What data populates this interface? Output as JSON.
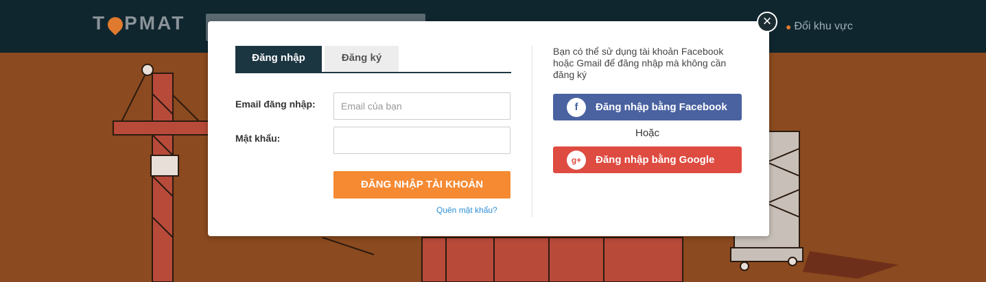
{
  "header": {
    "logo_text_left": "T",
    "logo_text_right": "PMAT",
    "region_label": "Đổi khu vực"
  },
  "modal": {
    "close_symbol": "×",
    "tabs": [
      {
        "label": "Đăng nhập",
        "active": true
      },
      {
        "label": "Đăng ký",
        "active": false
      }
    ],
    "email_label": "Email đăng nhập:",
    "email_placeholder": "Email của bạn",
    "email_value": "",
    "password_label": "Mật khẩu:",
    "password_value": "",
    "login_button": "ĐĂNG NHẬP TÀI KHOẢN",
    "forgot_link": "Quên mật khẩu?",
    "social_info": "Bạn có thể sử dụng tài khoản Facebook hoặc Gmail để đăng nhập mà không cần đăng ký",
    "facebook_button": "Đăng nhập bằng Facebook",
    "or_text": "Hoặc",
    "google_button": "Đăng nhập bằng Google",
    "facebook_icon": "f",
    "google_icon": "g+"
  },
  "colors": {
    "header_bg": "#10262f",
    "accent_orange": "#f58a33",
    "facebook_blue": "#4a62a0",
    "google_red": "#de4b41",
    "tab_active": "#1b3641"
  }
}
